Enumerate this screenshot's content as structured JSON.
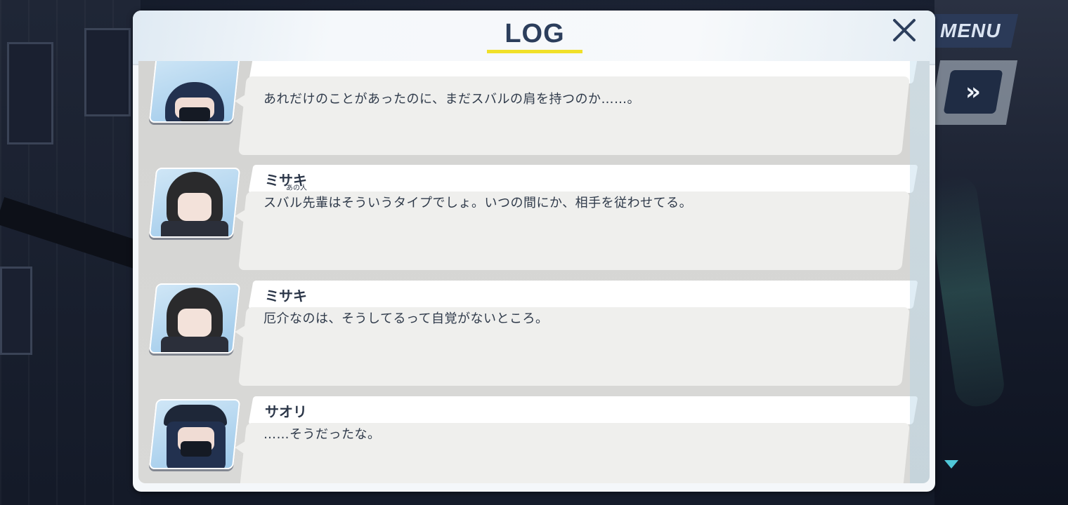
{
  "menu": {
    "label": "MENU"
  },
  "fast_forward": {
    "label": "»"
  },
  "log": {
    "title": "LOG",
    "close_icon": "close-icon"
  },
  "entries": [
    {
      "speaker": "",
      "ruby": "",
      "text": "あれだけのことがあったのに、まだスバルの肩を持つのか……。",
      "avatar": "saori"
    },
    {
      "speaker": "ミサキ",
      "ruby": "あの人",
      "text": "スバル先輩はそういうタイプでしょ。いつの間にか、相手を従わせてる。",
      "avatar": "misaki"
    },
    {
      "speaker": "ミサキ",
      "ruby": "",
      "text": "厄介なのは、そうしてるって自覚がないところ。",
      "avatar": "misaki"
    },
    {
      "speaker": "サオリ",
      "ruby": "",
      "text": "……そうだったな。",
      "avatar": "saori"
    }
  ],
  "colors": {
    "accent_underline": "#f0e02a",
    "title_text": "#2c3e5c",
    "bubble_bg": "#efefed",
    "scroll_indicator": "#4fc7d8"
  }
}
